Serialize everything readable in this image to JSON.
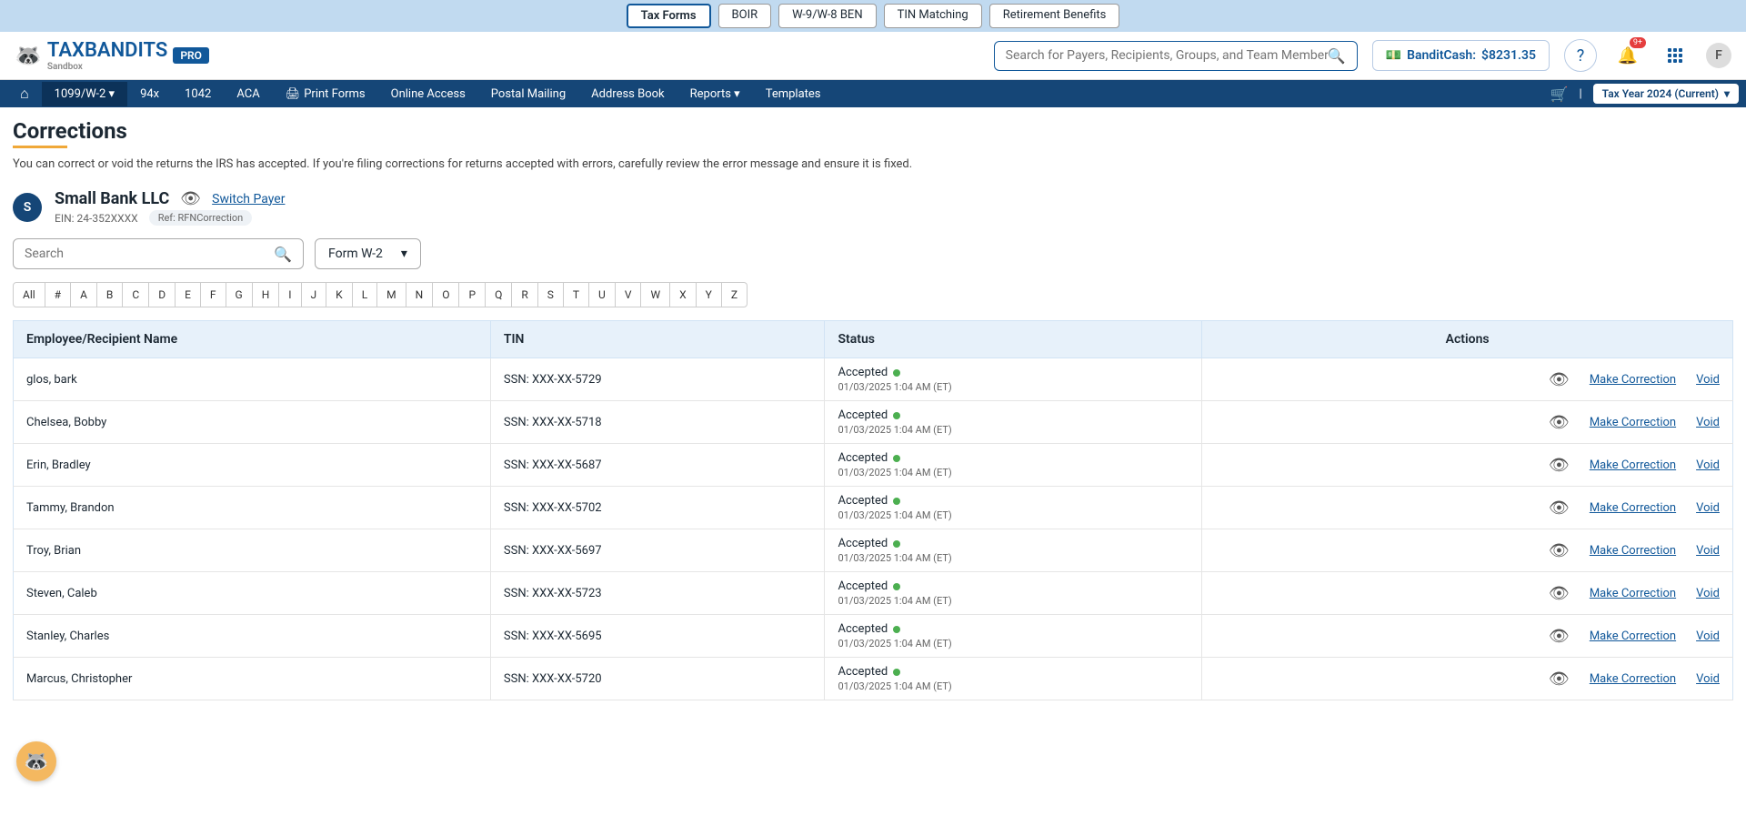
{
  "top_tabs": {
    "items": [
      "Tax Forms",
      "BOIR",
      "W-9/W-8 BEN",
      "TIN Matching",
      "Retirement Benefits"
    ],
    "active_index": 0
  },
  "header": {
    "brand": "TAX",
    "brand2": "BANDITS",
    "sandbox": "Sandbox",
    "pro": "PRO",
    "search_placeholder": "Search for Payers, Recipients, Groups, and Team Members",
    "bandit_cash_label": "BanditCash:",
    "bandit_cash_value": "$8231.35",
    "notif_count": "9+",
    "avatar_letter": "F"
  },
  "nav": {
    "items": [
      "1099/W-2",
      "94x",
      "1042",
      "ACA",
      "Print Forms",
      "Online Access",
      "Postal Mailing",
      "Address Book",
      "Reports",
      "Templates"
    ],
    "tax_year": "Tax Year 2024 (Current)"
  },
  "page": {
    "title": "Corrections",
    "description": "You can correct or void the returns the IRS has accepted. If you're filing corrections for returns accepted with errors, carefully review the error message and ensure it is fixed."
  },
  "payer": {
    "initial": "S",
    "name": "Small Bank LLC",
    "switch": "Switch Payer",
    "ein_label": "EIN:",
    "ein_value": "24-352XXXX",
    "ref": "Ref: RFNCorrection"
  },
  "controls": {
    "search_placeholder": "Search",
    "form_label": "Form W-2"
  },
  "alpha": [
    "All",
    "#",
    "A",
    "B",
    "C",
    "D",
    "E",
    "F",
    "G",
    "H",
    "I",
    "J",
    "K",
    "L",
    "M",
    "N",
    "O",
    "P",
    "Q",
    "R",
    "S",
    "T",
    "U",
    "V",
    "W",
    "X",
    "Y",
    "Z"
  ],
  "table": {
    "headers": {
      "name": "Employee/Recipient Name",
      "tin": "TIN",
      "status": "Status",
      "actions": "Actions"
    },
    "status_accepted": "Accepted",
    "make_correction": "Make Correction",
    "void": "Void",
    "rows": [
      {
        "name": "glos, bark",
        "tin": "SSN: XXX-XX-5729",
        "time": "01/03/2025 1:04 AM (ET)"
      },
      {
        "name": "Chelsea, Bobby",
        "tin": "SSN: XXX-XX-5718",
        "time": "01/03/2025 1:04 AM (ET)"
      },
      {
        "name": "Erin, Bradley",
        "tin": "SSN: XXX-XX-5687",
        "time": "01/03/2025 1:04 AM (ET)"
      },
      {
        "name": "Tammy, Brandon",
        "tin": "SSN: XXX-XX-5702",
        "time": "01/03/2025 1:04 AM (ET)"
      },
      {
        "name": "Troy, Brian",
        "tin": "SSN: XXX-XX-5697",
        "time": "01/03/2025 1:04 AM (ET)"
      },
      {
        "name": "Steven, Caleb",
        "tin": "SSN: XXX-XX-5723",
        "time": "01/03/2025 1:04 AM (ET)"
      },
      {
        "name": "Stanley, Charles",
        "tin": "SSN: XXX-XX-5695",
        "time": "01/03/2025 1:04 AM (ET)"
      },
      {
        "name": "Marcus, Christopher",
        "tin": "SSN: XXX-XX-5720",
        "time": "01/03/2025 1:04 AM (ET)"
      }
    ]
  }
}
